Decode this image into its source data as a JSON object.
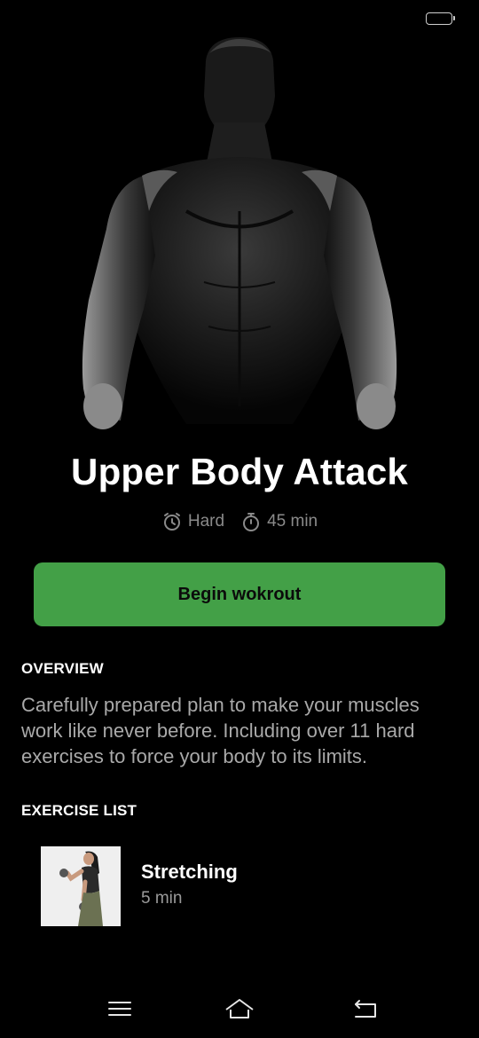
{
  "status_bar": {
    "battery_icon": "battery-icon"
  },
  "hero": {
    "image": "muscular-man-silhouette"
  },
  "workout": {
    "title": "Upper Body Attack",
    "difficulty": "Hard",
    "duration": "45 min",
    "difficulty_icon": "alarm-clock-icon",
    "duration_icon": "stopwatch-icon"
  },
  "begin_button": {
    "label": "Begin wokrout",
    "color": "#43a047"
  },
  "overview": {
    "title": "OVERVIEW",
    "text": "Carefully prepared plan to make your muscles work like never before. Including over 11 hard exercises to force your body to its limits."
  },
  "exercise_list": {
    "title": "EXERCISE LIST",
    "items": [
      {
        "name": "Stretching",
        "duration": "5 min",
        "thumbnail": "woman-with-dumbbells"
      }
    ]
  },
  "nav_bar": {
    "icons": [
      "menu-icon",
      "home-icon",
      "back-icon"
    ]
  }
}
